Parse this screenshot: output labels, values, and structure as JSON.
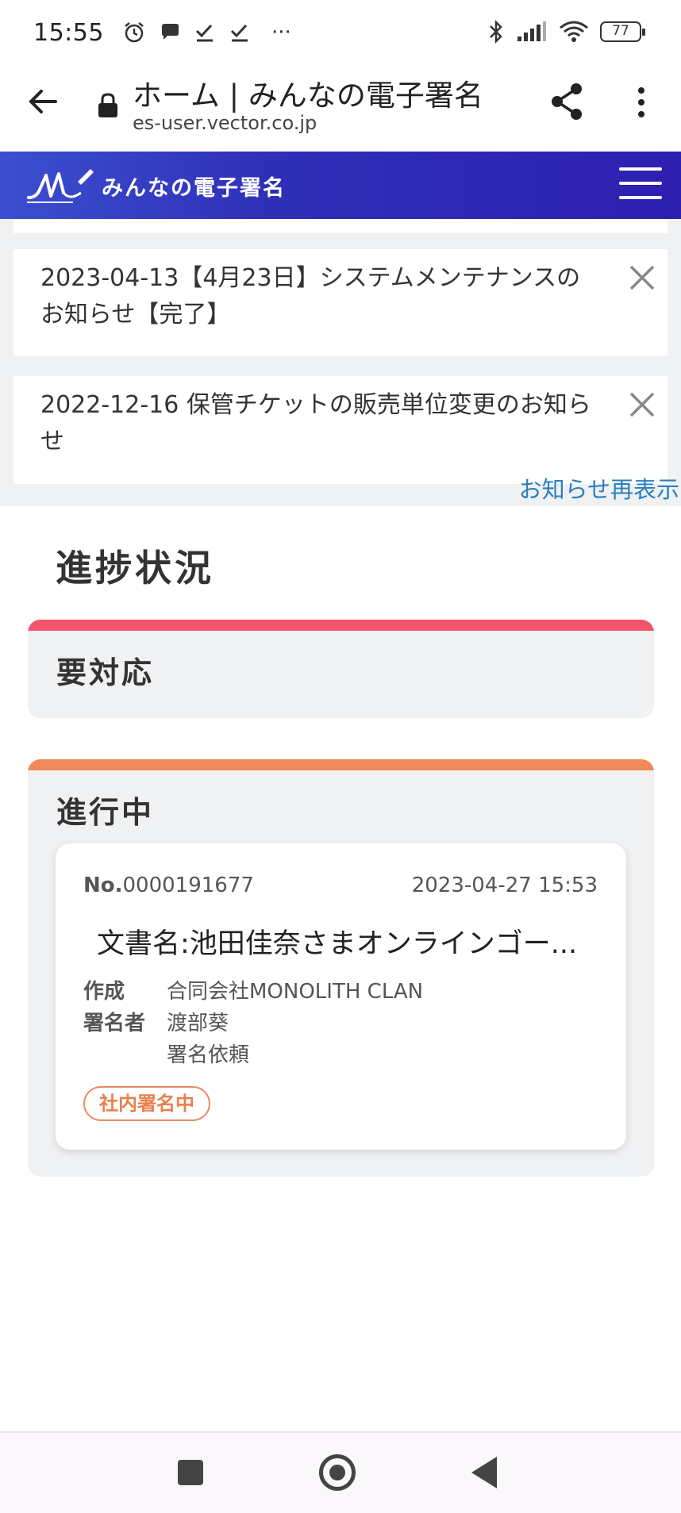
{
  "status_bar": {
    "time": "15:55",
    "left_icons": [
      "alarm-icon",
      "chat-bubble-icon",
      "check-icon",
      "check-icon",
      "more-notifications-icon"
    ],
    "more_text": "···",
    "right_icons": [
      "bluetooth-icon",
      "signal-icon",
      "wifi-icon",
      "battery-icon"
    ],
    "battery": "77"
  },
  "browser": {
    "page_title": "ホーム | みんなの電子署名",
    "url": "es-user.vector.co.jp"
  },
  "site_header": {
    "logo_text": "みんなの電子署名",
    "brand_gradient": [
      "#3b4fcf",
      "#2d1fb0"
    ]
  },
  "notices": {
    "items": [
      {
        "text": "2023-04-13【4月23日】システムメンテナンスのお知らせ【完了】"
      },
      {
        "text": "2022-12-16 保管チケットの販売単位変更のお知らせ"
      }
    ],
    "redisplay_label": "お知らせ再表示"
  },
  "progress": {
    "title": "進捗状況",
    "action_required": {
      "title": "要対応",
      "accent": "#f2546b"
    },
    "in_progress": {
      "title": "進行中",
      "accent": "#f08a5a",
      "document": {
        "no_label": "No.",
        "no_value": "0000191677",
        "datetime": "2023-04-27 15:53",
        "name": "文書名:池田佳奈さまオンラインゴー...",
        "creator_label": "作成",
        "creator_value": "合同会社MONOLITH CLAN",
        "signer_label": "署名者",
        "signer_value": "渡部葵",
        "signer_status": "署名依頼",
        "badge": "社内署名中"
      }
    }
  }
}
